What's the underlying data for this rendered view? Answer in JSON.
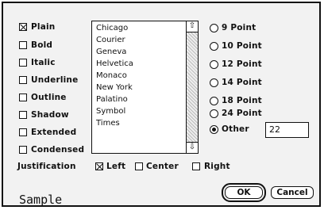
{
  "styles": [
    {
      "label": "Plain",
      "checked": true
    },
    {
      "label": "Bold",
      "checked": false
    },
    {
      "label": "Italic",
      "checked": false
    },
    {
      "label": "Underline",
      "checked": false
    },
    {
      "label": "Outline",
      "checked": false
    },
    {
      "label": "Shadow",
      "checked": false
    },
    {
      "label": "Extended",
      "checked": false
    },
    {
      "label": "Condensed",
      "checked": false
    }
  ],
  "fonts": [
    "Chicago",
    "Courier",
    "Geneva",
    "Helvetica",
    "Monaco",
    "New York",
    "Palatino",
    "Symbol",
    "Times"
  ],
  "sizes": [
    {
      "label": "9 Point",
      "selected": false
    },
    {
      "label": "10 Point",
      "selected": false
    },
    {
      "label": "12 Point",
      "selected": false
    },
    {
      "label": "14 Point",
      "selected": false
    },
    {
      "label": "18 Point",
      "selected": false
    },
    {
      "label": "24 Point",
      "selected": false
    },
    {
      "label": "Other",
      "selected": true
    }
  ],
  "other_size_value": "22",
  "justification": {
    "label": "Justification",
    "options": [
      {
        "label": "Left",
        "checked": true
      },
      {
        "label": "Center",
        "checked": false
      },
      {
        "label": "Right",
        "checked": false
      }
    ]
  },
  "sample_text": "Sample",
  "buttons": {
    "ok": "OK",
    "cancel": "Cancel"
  }
}
